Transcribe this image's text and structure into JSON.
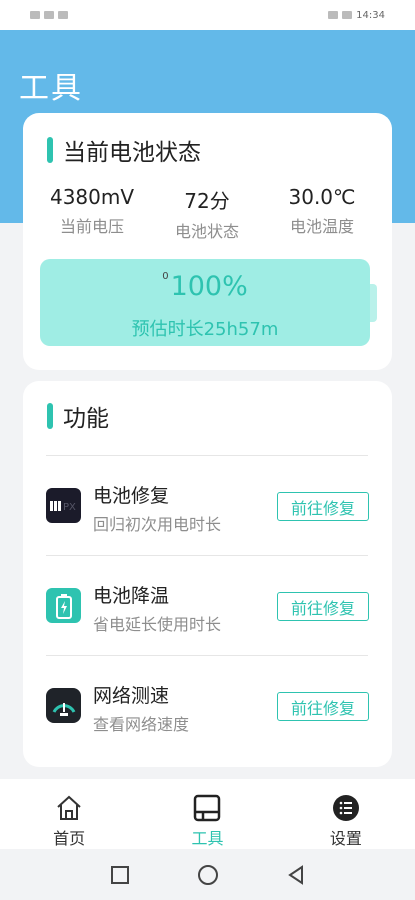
{
  "status_bar": {
    "time": "14:34"
  },
  "header": {
    "title": "工具"
  },
  "battery_card": {
    "section_title": "当前电池状态",
    "stats": [
      {
        "value": "4380mV",
        "label": "当前电压"
      },
      {
        "value": "72分",
        "label": "电池状态"
      },
      {
        "value": "30.0℃",
        "label": "电池温度"
      }
    ],
    "battery": {
      "small_label": "0",
      "percent": "100%",
      "estimate": "预估时长25h57m",
      "level": 1.0
    }
  },
  "functions_card": {
    "section_title": "功能",
    "items": [
      {
        "name": "电池修复",
        "desc": "回归初次用电时长",
        "button": "前往修复",
        "icon": "battery-repair-icon"
      },
      {
        "name": "电池降温",
        "desc": "省电延长使用时长",
        "button": "前往修复",
        "icon": "battery-cooling-icon"
      },
      {
        "name": "网络测速",
        "desc": "查看网络速度",
        "button": "前往修复",
        "icon": "speedometer-icon"
      }
    ]
  },
  "bottom_nav": {
    "items": [
      {
        "label": "首页",
        "icon": "home-icon"
      },
      {
        "label": "工具",
        "icon": "tools-icon",
        "active": true
      },
      {
        "label": "设置",
        "icon": "settings-icon"
      }
    ]
  },
  "colors": {
    "accent": "#2ec3b0",
    "header_bg": "#63b9e9",
    "battery_fill": "#9fede4"
  }
}
